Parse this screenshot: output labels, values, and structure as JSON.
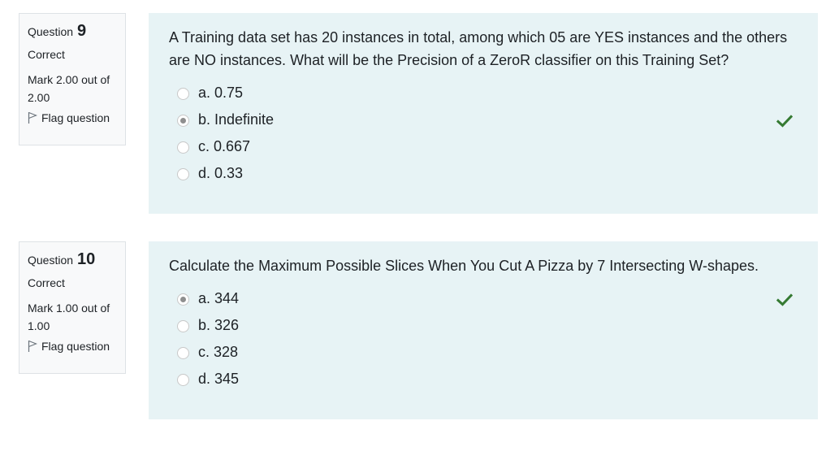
{
  "questions": [
    {
      "label": "Question",
      "number": "9",
      "state": "Correct",
      "grade": "Mark 2.00 out of 2.00",
      "flag_label": "Flag question",
      "text": "A Training data set has 20 instances in total, among which 05 are YES instances and the others are NO instances. What will be the Precision of a ZeroR classifier on this Training Set?",
      "options": [
        "a. 0.75",
        "b. Indefinite",
        "c. 0.667",
        "d. 0.33"
      ],
      "selected_index": 1
    },
    {
      "label": "Question",
      "number": "10",
      "state": "Correct",
      "grade": "Mark 1.00 out of 1.00",
      "flag_label": "Flag question",
      "text": "Calculate the Maximum Possible Slices When You Cut A Pizza by 7 Intersecting W-shapes.",
      "options": [
        "a. 344",
        "b. 326",
        "c. 328",
        "d. 345"
      ],
      "selected_index": 0
    }
  ],
  "colors": {
    "content_bg": "#e7f3f5",
    "info_bg": "#f8f9fa",
    "correct_green": "#357a32"
  },
  "icons": {
    "flag": "flag-icon",
    "correct": "check-icon"
  }
}
